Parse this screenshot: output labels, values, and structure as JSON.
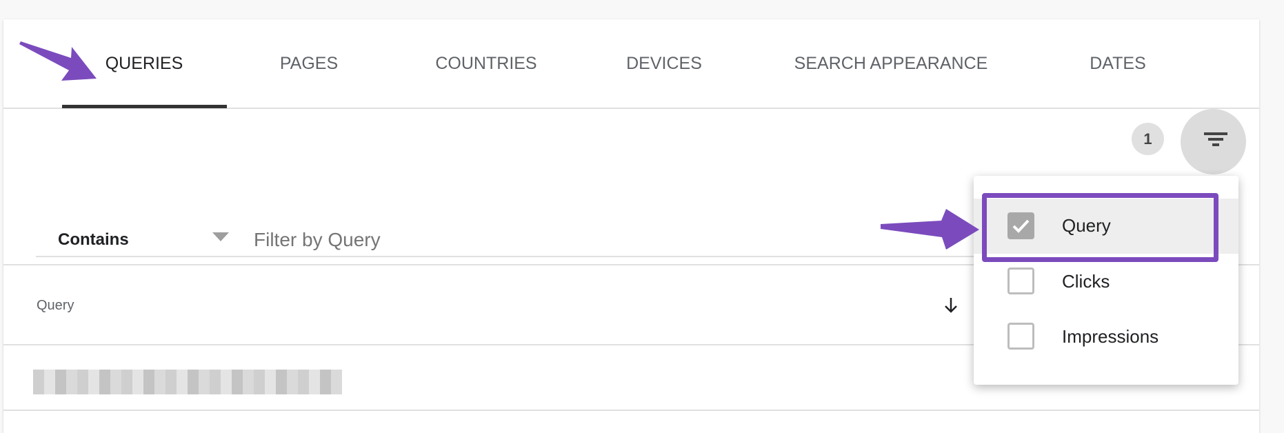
{
  "tabs": [
    {
      "label": "QUERIES",
      "active": true
    },
    {
      "label": "PAGES"
    },
    {
      "label": "COUNTRIES"
    },
    {
      "label": "DEVICES"
    },
    {
      "label": "SEARCH APPEARANCE"
    },
    {
      "label": "DATES"
    }
  ],
  "filter": {
    "badge_count": "1",
    "icon": "filter-list-icon",
    "operator": "Contains",
    "placeholder": "Filter by Query"
  },
  "table": {
    "column_query": "Query",
    "sort_icon": "arrow-down-icon"
  },
  "menu": {
    "items": [
      {
        "label": "Query",
        "checked": true
      },
      {
        "label": "Clicks",
        "checked": false
      },
      {
        "label": "Impressions",
        "checked": false
      }
    ]
  },
  "colors": {
    "annotation": "#7b4bbd",
    "tab_indicator": "#333333"
  }
}
